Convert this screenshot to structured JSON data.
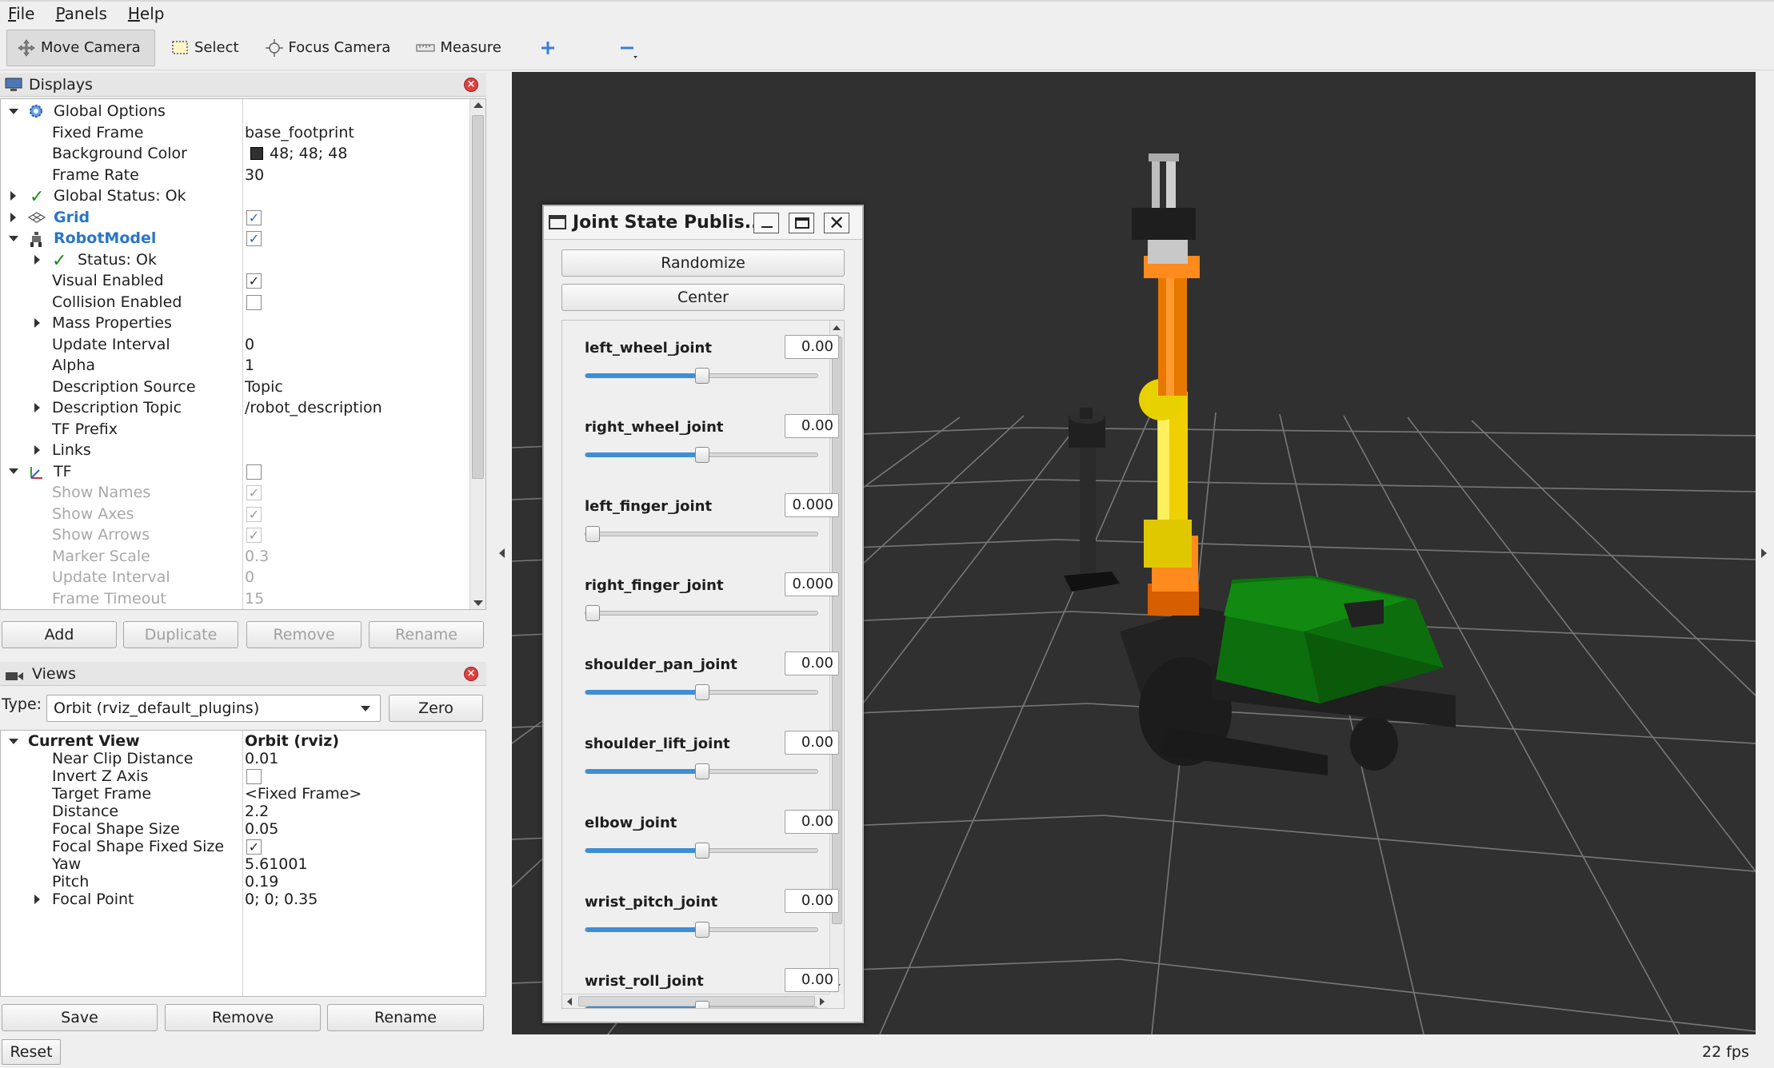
{
  "menu": {
    "items": [
      "File",
      "Panels",
      "Help"
    ]
  },
  "toolbar": {
    "move_camera": "Move Camera",
    "select": "Select",
    "focus_camera": "Focus Camera",
    "measure": "Measure"
  },
  "displays": {
    "title": "Displays",
    "rows": [
      {
        "name": "Global Options",
        "value": ""
      },
      {
        "name": "Fixed Frame",
        "value": "base_footprint"
      },
      {
        "name": "Background Color",
        "value": "48; 48; 48"
      },
      {
        "name": "Frame Rate",
        "value": "30"
      },
      {
        "name": "Global Status: Ok",
        "value": ""
      },
      {
        "name": "Grid",
        "value": ""
      },
      {
        "name": "RobotModel",
        "value": ""
      },
      {
        "name": "Status: Ok",
        "value": ""
      },
      {
        "name": "Visual Enabled",
        "value": ""
      },
      {
        "name": "Collision Enabled",
        "value": ""
      },
      {
        "name": "Mass Properties",
        "value": ""
      },
      {
        "name": "Update Interval",
        "value": "0"
      },
      {
        "name": "Alpha",
        "value": "1"
      },
      {
        "name": "Description Source",
        "value": "Topic"
      },
      {
        "name": "Description Topic",
        "value": "/robot_description"
      },
      {
        "name": "TF Prefix",
        "value": ""
      },
      {
        "name": "Links",
        "value": ""
      },
      {
        "name": "TF",
        "value": ""
      },
      {
        "name": "Show Names",
        "value": ""
      },
      {
        "name": "Show Axes",
        "value": ""
      },
      {
        "name": "Show Arrows",
        "value": ""
      },
      {
        "name": "Marker Scale",
        "value": "0.3"
      },
      {
        "name": "Update Interval",
        "value": "0"
      },
      {
        "name": "Frame Timeout",
        "value": "15"
      }
    ],
    "bg_color": "#303030",
    "buttons": {
      "add": "Add",
      "duplicate": "Duplicate",
      "remove": "Remove",
      "rename": "Rename"
    }
  },
  "views": {
    "title": "Views",
    "type_label": "Type:",
    "type_value": "Orbit (rviz_default_plugins)",
    "zero": "Zero",
    "rows": [
      {
        "name": "Current View",
        "value": "Orbit (rviz)"
      },
      {
        "name": "Near Clip Distance",
        "value": "0.01"
      },
      {
        "name": "Invert Z Axis",
        "value": ""
      },
      {
        "name": "Target Frame",
        "value": "<Fixed Frame>"
      },
      {
        "name": "Distance",
        "value": "2.2"
      },
      {
        "name": "Focal Shape Size",
        "value": "0.05"
      },
      {
        "name": "Focal Shape Fixed Size",
        "value": ""
      },
      {
        "name": "Yaw",
        "value": "5.61001"
      },
      {
        "name": "Pitch",
        "value": "0.19"
      },
      {
        "name": "Focal Point",
        "value": "0; 0; 0.35"
      }
    ],
    "buttons": {
      "save": "Save",
      "remove": "Remove",
      "rename": "Rename"
    }
  },
  "status": {
    "reset": "Reset",
    "fps": "22 fps"
  },
  "jsp": {
    "title": "Joint State Publis...",
    "randomize": "Randomize",
    "center": "Center",
    "joints": [
      {
        "name": "left_wheel_joint",
        "value": "0.00",
        "level": 0.5
      },
      {
        "name": "right_wheel_joint",
        "value": "0.00",
        "level": 0.5
      },
      {
        "name": "left_finger_joint",
        "value": "0.000",
        "level": 0.0
      },
      {
        "name": "right_finger_joint",
        "value": "0.000",
        "level": 0.0
      },
      {
        "name": "shoulder_pan_joint",
        "value": "0.00",
        "level": 0.5
      },
      {
        "name": "shoulder_lift_joint",
        "value": "0.00",
        "level": 0.5
      },
      {
        "name": "elbow_joint",
        "value": "0.00",
        "level": 0.5
      },
      {
        "name": "wrist_pitch_joint",
        "value": "0.00",
        "level": 0.5
      },
      {
        "name": "wrist_roll_joint",
        "value": "0.00",
        "level": 0.5
      }
    ]
  }
}
